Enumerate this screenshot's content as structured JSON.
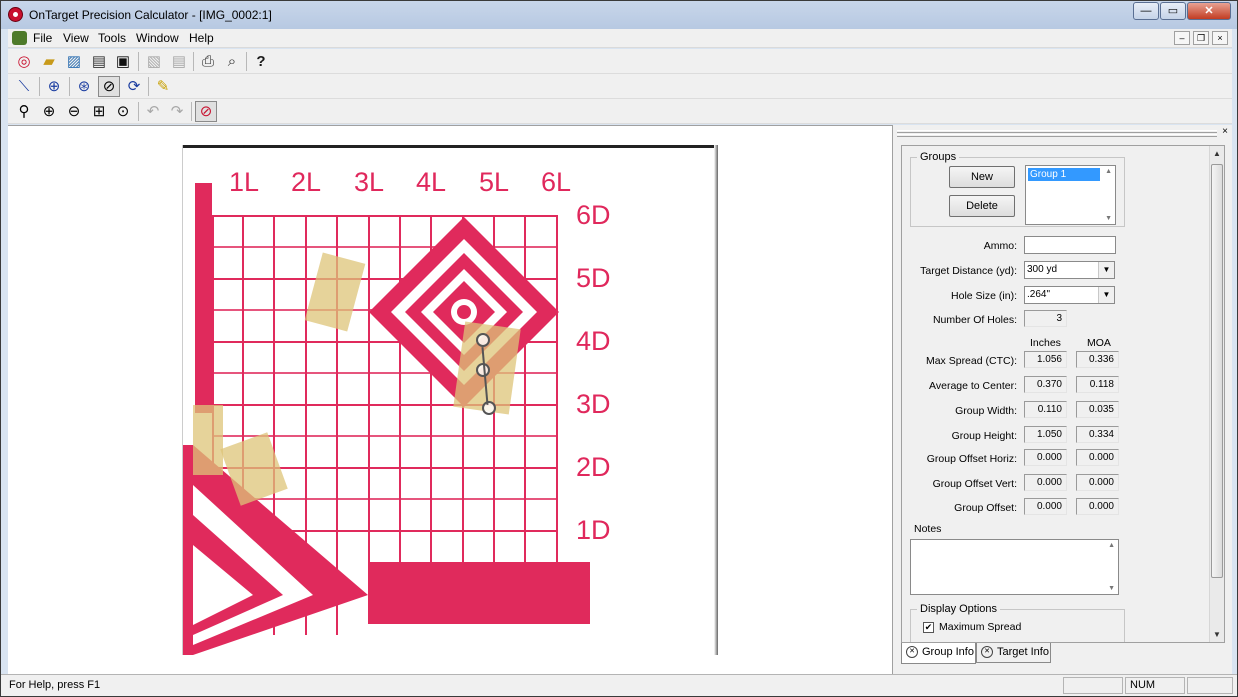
{
  "window": {
    "title": "OnTarget Precision Calculator - [IMG_0002:1]"
  },
  "titlebar_buttons": {
    "minimize": "—",
    "maximize": "▭",
    "close": "✕"
  },
  "menu": {
    "file": "File",
    "view": "View",
    "tools": "Tools",
    "window": "Window",
    "help": "Help"
  },
  "mdi_buttons": {
    "minimize": "–",
    "restore": "❐",
    "close": "×"
  },
  "toolbar1_icons": [
    "new-target-icon",
    "open-icon",
    "open-image-icon",
    "scan-icon",
    "save-icon",
    "export-icon",
    "import-icon",
    "print-icon",
    "print-preview-icon",
    "help-icon"
  ],
  "toolbar2_icons": [
    "line-tool-icon",
    "crosshair-icon",
    "group-tool-icon",
    "select-hole-icon",
    "find-holes-icon",
    "ruler-icon"
  ],
  "toolbar3_icons": [
    "zoom-icon",
    "zoom-in-icon",
    "zoom-out-icon",
    "zoom-fit-icon",
    "zoom-actual-icon",
    "undo-icon",
    "redo-icon",
    "target-settings-icon"
  ],
  "target": {
    "columns": [
      "1L",
      "2L",
      "3L",
      "4L",
      "5L",
      "6L"
    ],
    "rows": [
      "6D",
      "5D",
      "4D",
      "3D",
      "2D",
      "1D"
    ]
  },
  "groups": {
    "title": "Groups",
    "new_label": "New",
    "delete_label": "Delete",
    "items": [
      "Group 1"
    ]
  },
  "fields": {
    "ammo_label": "Ammo:",
    "ammo_value": "",
    "distance_label": "Target Distance (yd):",
    "distance_value": "300 yd",
    "hole_size_label": "Hole Size (in):",
    "hole_size_value": ".264\"",
    "num_holes_label": "Number Of Holes:",
    "num_holes_value": "3"
  },
  "measurements": {
    "col_inches": "Inches",
    "col_moa": "MOA",
    "rows": [
      {
        "label": "Max Spread (CTC):",
        "inches": "1.056",
        "moa": "0.336"
      },
      {
        "label": "Average to Center:",
        "inches": "0.370",
        "moa": "0.118"
      },
      {
        "label": "Group Width:",
        "inches": "0.110",
        "moa": "0.035"
      },
      {
        "label": "Group Height:",
        "inches": "1.050",
        "moa": "0.334"
      },
      {
        "label": "Group Offset Horiz:",
        "inches": "0.000",
        "moa": "0.000"
      },
      {
        "label": "Group Offset Vert:",
        "inches": "0.000",
        "moa": "0.000"
      },
      {
        "label": "Group Offset:",
        "inches": "0.000",
        "moa": "0.000"
      }
    ]
  },
  "notes": {
    "label": "Notes",
    "value": ""
  },
  "display_options": {
    "title": "Display Options",
    "max_spread_label": "Maximum Spread",
    "max_spread_checked": true
  },
  "tabs": {
    "group_info": "Group Info",
    "target_info": "Target Info"
  },
  "status": {
    "help_text": "For Help, press F1",
    "num": "NUM"
  },
  "colors": {
    "target_red": "#e02a5c",
    "tape": "#dec478",
    "selection": "#3399ff"
  }
}
